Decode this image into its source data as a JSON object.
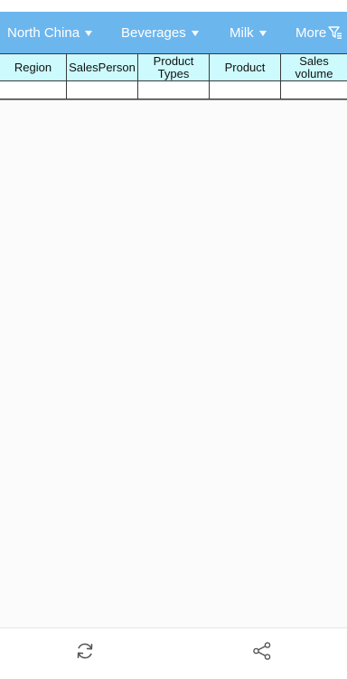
{
  "filters": [
    {
      "label": "North China"
    },
    {
      "label": "Beverages"
    },
    {
      "label": "Milk"
    }
  ],
  "more": {
    "label": "More",
    "icon": "filter-icon"
  },
  "table": {
    "columns": [
      "Region",
      "SalesPerson",
      "Product Types",
      "Product",
      "Sales volume"
    ]
  },
  "toolbar": {
    "refresh_icon": "refresh-icon",
    "share_icon": "share-icon"
  },
  "colors": {
    "filter_bar": "#6cb6ee",
    "header_cell": "#ccfafd"
  }
}
